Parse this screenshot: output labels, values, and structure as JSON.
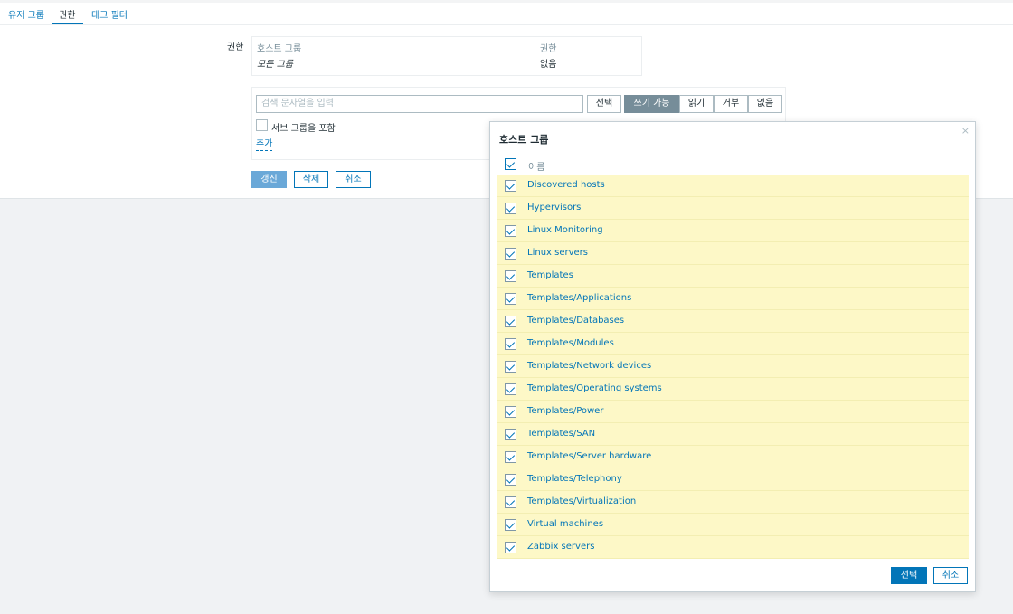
{
  "tabs": [
    {
      "label": "유저 그룹",
      "active": false
    },
    {
      "label": "권한",
      "active": true
    },
    {
      "label": "태그 필터",
      "active": false
    }
  ],
  "permissions": {
    "label": "권한",
    "table": {
      "headers": [
        "호스트 그룹",
        "권한"
      ],
      "rows": [
        [
          "모든 그룹",
          "없음"
        ]
      ]
    },
    "search_placeholder": "검색 문자열을 입력",
    "select_label": "선택",
    "levels": [
      "쓰기 가능",
      "읽기",
      "거부",
      "없음"
    ],
    "active_level": "쓰기 가능",
    "include_subgroups_label": "서브 그룹을 포함",
    "add_label": "추가"
  },
  "form_buttons": {
    "update": "갱신",
    "delete": "삭제",
    "cancel": "취소"
  },
  "modal": {
    "title": "호스트 그룹",
    "close_symbol": "×",
    "column_header": "이름",
    "items": [
      "Discovered hosts",
      "Hypervisors",
      "Linux Monitoring",
      "Linux servers",
      "Templates",
      "Templates/Applications",
      "Templates/Databases",
      "Templates/Modules",
      "Templates/Network devices",
      "Templates/Operating systems",
      "Templates/Power",
      "Templates/SAN",
      "Templates/Server hardware",
      "Templates/Telephony",
      "Templates/Virtualization",
      "Virtual machines",
      "Zabbix servers"
    ],
    "select_button": "선택",
    "cancel_button": "취소"
  }
}
